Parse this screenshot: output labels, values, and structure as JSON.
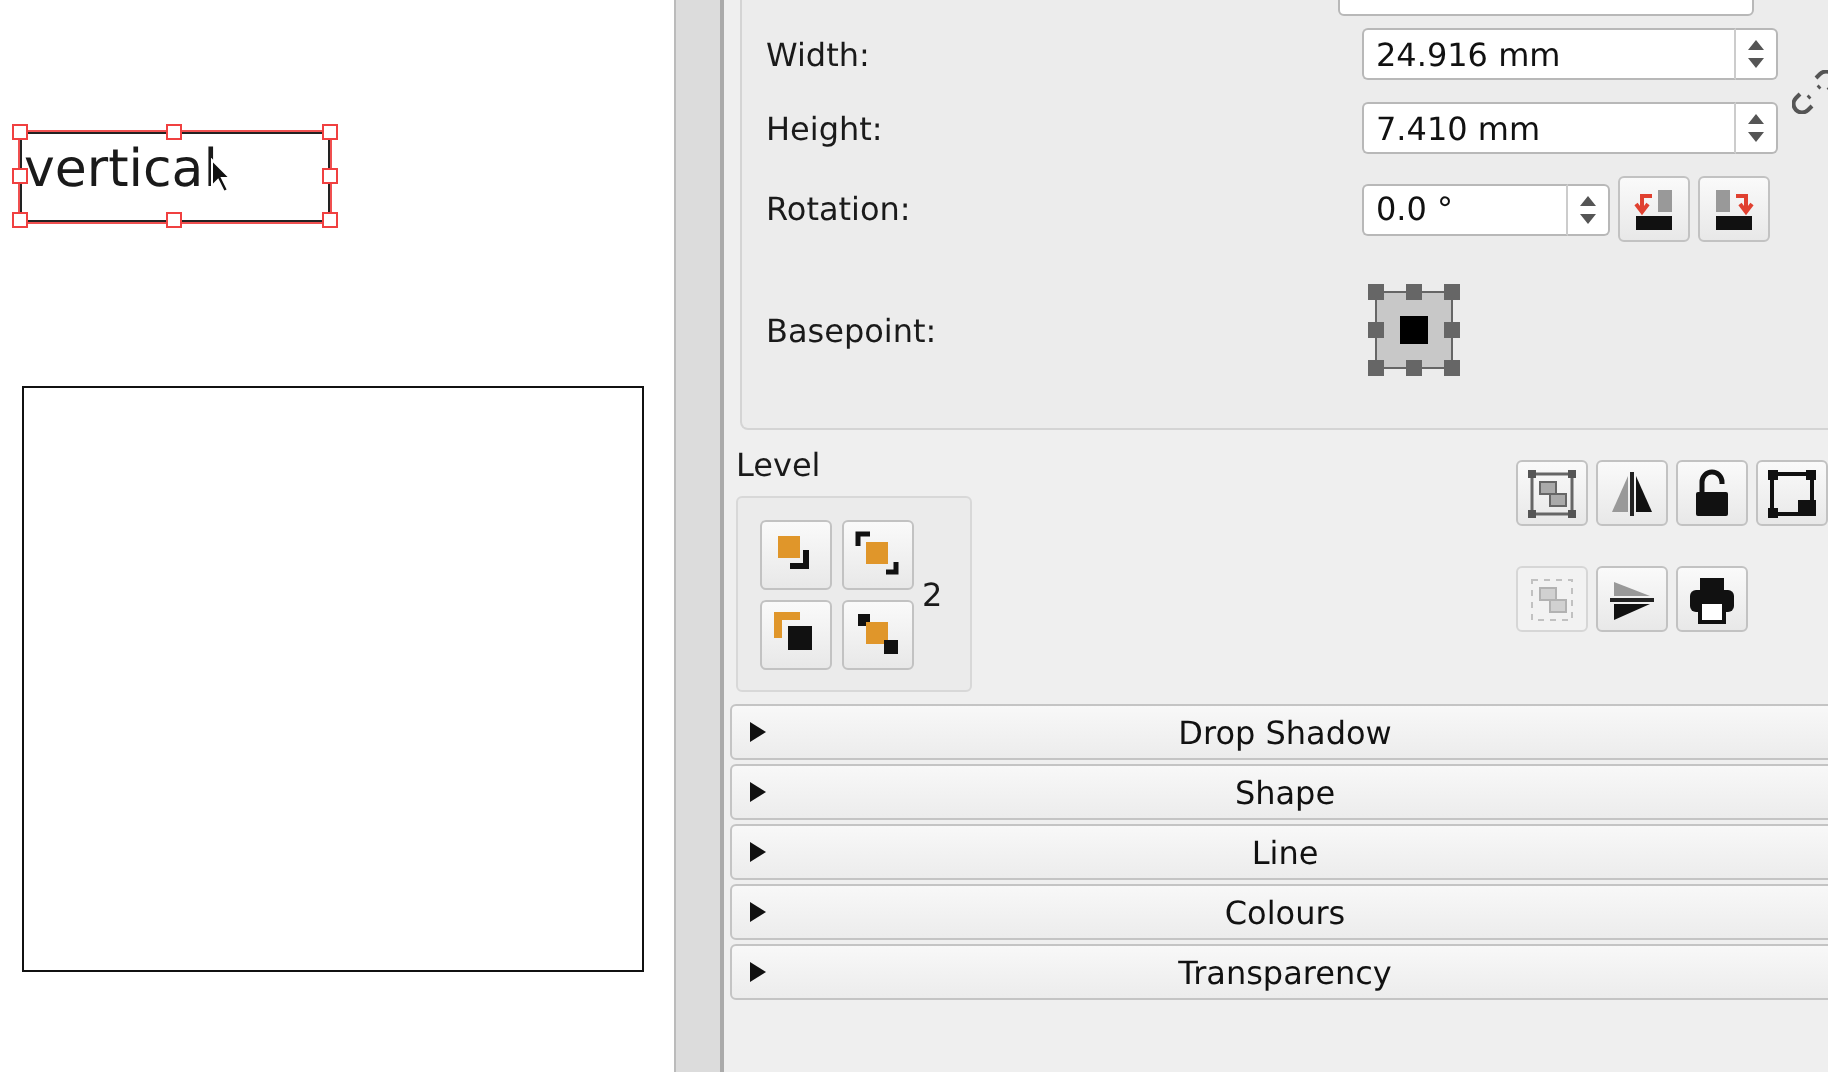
{
  "canvas": {
    "text_frame": {
      "text": "vertical",
      "selected": true
    }
  },
  "geometry": {
    "fields": [
      {
        "kind": "size",
        "label": "Width:",
        "value": "24.916 mm"
      },
      {
        "kind": "size",
        "label": "Height:",
        "value": "7.410 mm"
      },
      {
        "kind": "rotation",
        "label": "Rotation:",
        "value": "0.0 °"
      }
    ],
    "basepoint_label": "Basepoint:"
  },
  "level": {
    "label": "Level",
    "value": "2"
  },
  "tool_buttons": [
    [
      {
        "kind": "group",
        "disabled": false
      },
      {
        "kind": "flip-horizontal",
        "disabled": false
      },
      {
        "kind": "lock",
        "disabled": false
      },
      {
        "kind": "lock-size",
        "disabled": false
      }
    ],
    [
      {
        "kind": "ungroup",
        "disabled": true
      },
      {
        "kind": "flip-vertical",
        "disabled": false
      },
      {
        "kind": "print",
        "disabled": false
      }
    ]
  ],
  "sections": [
    {
      "label": "Drop Shadow",
      "expanded": false
    },
    {
      "label": "Shape",
      "expanded": false
    },
    {
      "label": "Line",
      "expanded": false
    },
    {
      "label": "Colours",
      "expanded": false
    },
    {
      "label": "Transparency",
      "expanded": false
    }
  ]
}
